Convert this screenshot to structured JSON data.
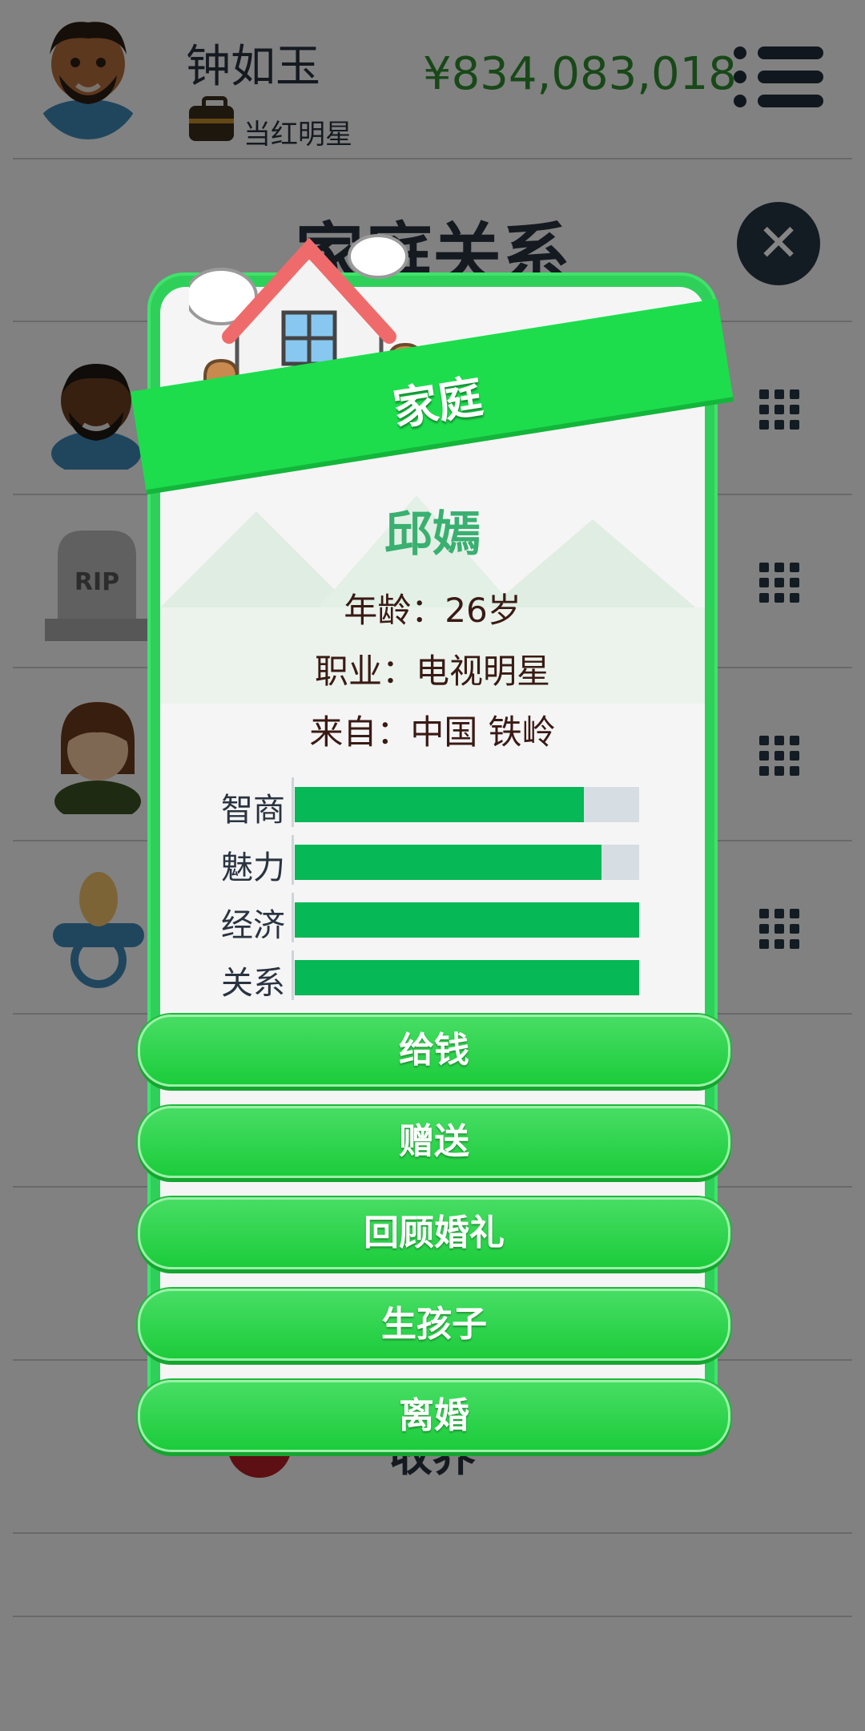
{
  "header": {
    "player_name": "钟如玉",
    "job": "当红明星",
    "money": "¥834,083,018"
  },
  "page": {
    "title": "家庭关系",
    "list_visible_label": "收养"
  },
  "modal": {
    "banner": "家庭",
    "person_name": "邱嫣",
    "age_line": "年龄：26岁",
    "job_line": "职业：电视明星",
    "from_line": "来自：中国 铁岭",
    "stats": [
      {
        "label": "智商",
        "value": 0.84
      },
      {
        "label": "魅力",
        "value": 0.89
      },
      {
        "label": "经济",
        "value": 1.0
      },
      {
        "label": "关系",
        "value": 1.0
      }
    ],
    "buttons": [
      "给钱",
      "赠送",
      "回顾婚礼",
      "生孩子",
      "离婚"
    ]
  },
  "colors": {
    "accent_green": "#1ddd4d",
    "stat_fill": "#06b856",
    "money": "#2f8a2f",
    "name": "#39b070"
  },
  "icons": [
    "avatar",
    "briefcase-icon",
    "menu-icon",
    "close-icon",
    "grid-menu-icon",
    "tombstone-icon",
    "pacifier-icon",
    "heart-icon",
    "house-icon"
  ]
}
